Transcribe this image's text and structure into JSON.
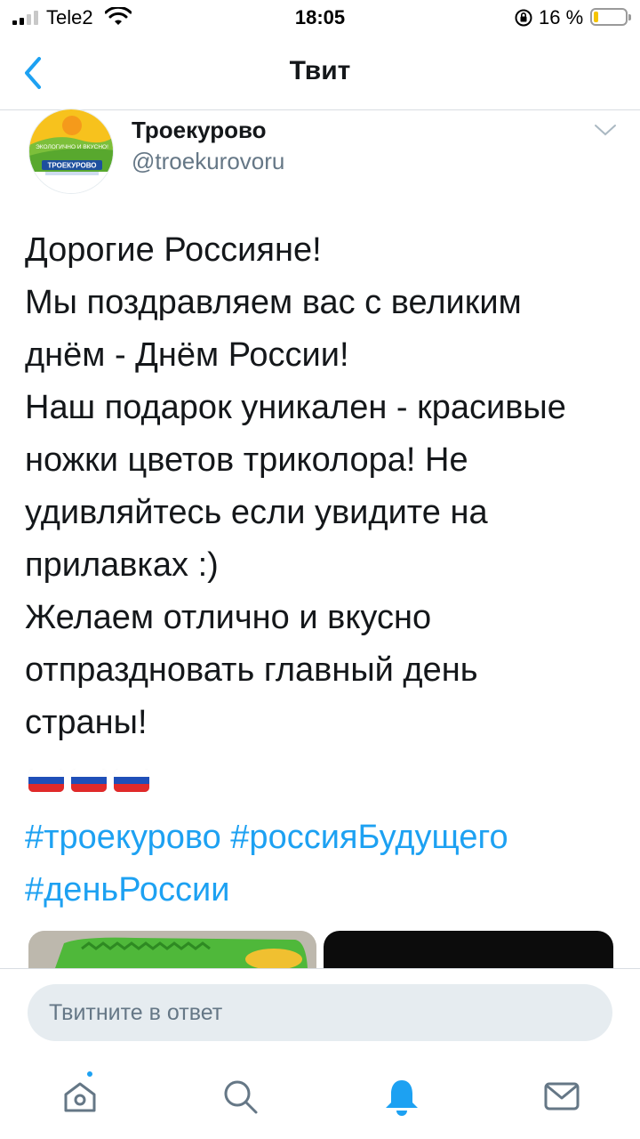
{
  "status_bar": {
    "carrier": "Tele2",
    "time": "18:05",
    "battery_percent": "16 %",
    "battery_level": 0.16
  },
  "nav": {
    "title": "Твит"
  },
  "tweet": {
    "author_name": "Троекурово",
    "author_handle": "@troekurovoru",
    "avatar_badge_top": "ЭКОЛОГИЧНО И ВКУСНО!",
    "avatar_badge_brand": "ТРОЕКУРОВО",
    "text_lines": [
      "Дорогие Россияне!",
      "Мы поздравляем вас с великим",
      "днём - Днём России!",
      "Наш подарок уникален - красивые",
      "ножки цветов триколора! Не",
      "удивляйтесь если увидите на",
      "прилавках :)",
      "Желаем отлично и вкусно",
      "отпраздновать главный день",
      "страны!"
    ],
    "flag_count": 3,
    "hashtags": [
      "#троекурово",
      "#россияБудущего",
      "#деньРоссии"
    ]
  },
  "reply": {
    "placeholder": "Твитните в ответ"
  },
  "tab_bar": {
    "items": [
      "home-icon",
      "search-icon",
      "notifications-icon",
      "messages-icon"
    ],
    "active": "notifications-icon"
  },
  "colors": {
    "accent": "#1da1f2",
    "text": "#14171a",
    "secondary": "#657786",
    "flag_white": "#ffffff",
    "flag_blue": "#1f4fb8",
    "flag_red": "#e02a2a"
  }
}
